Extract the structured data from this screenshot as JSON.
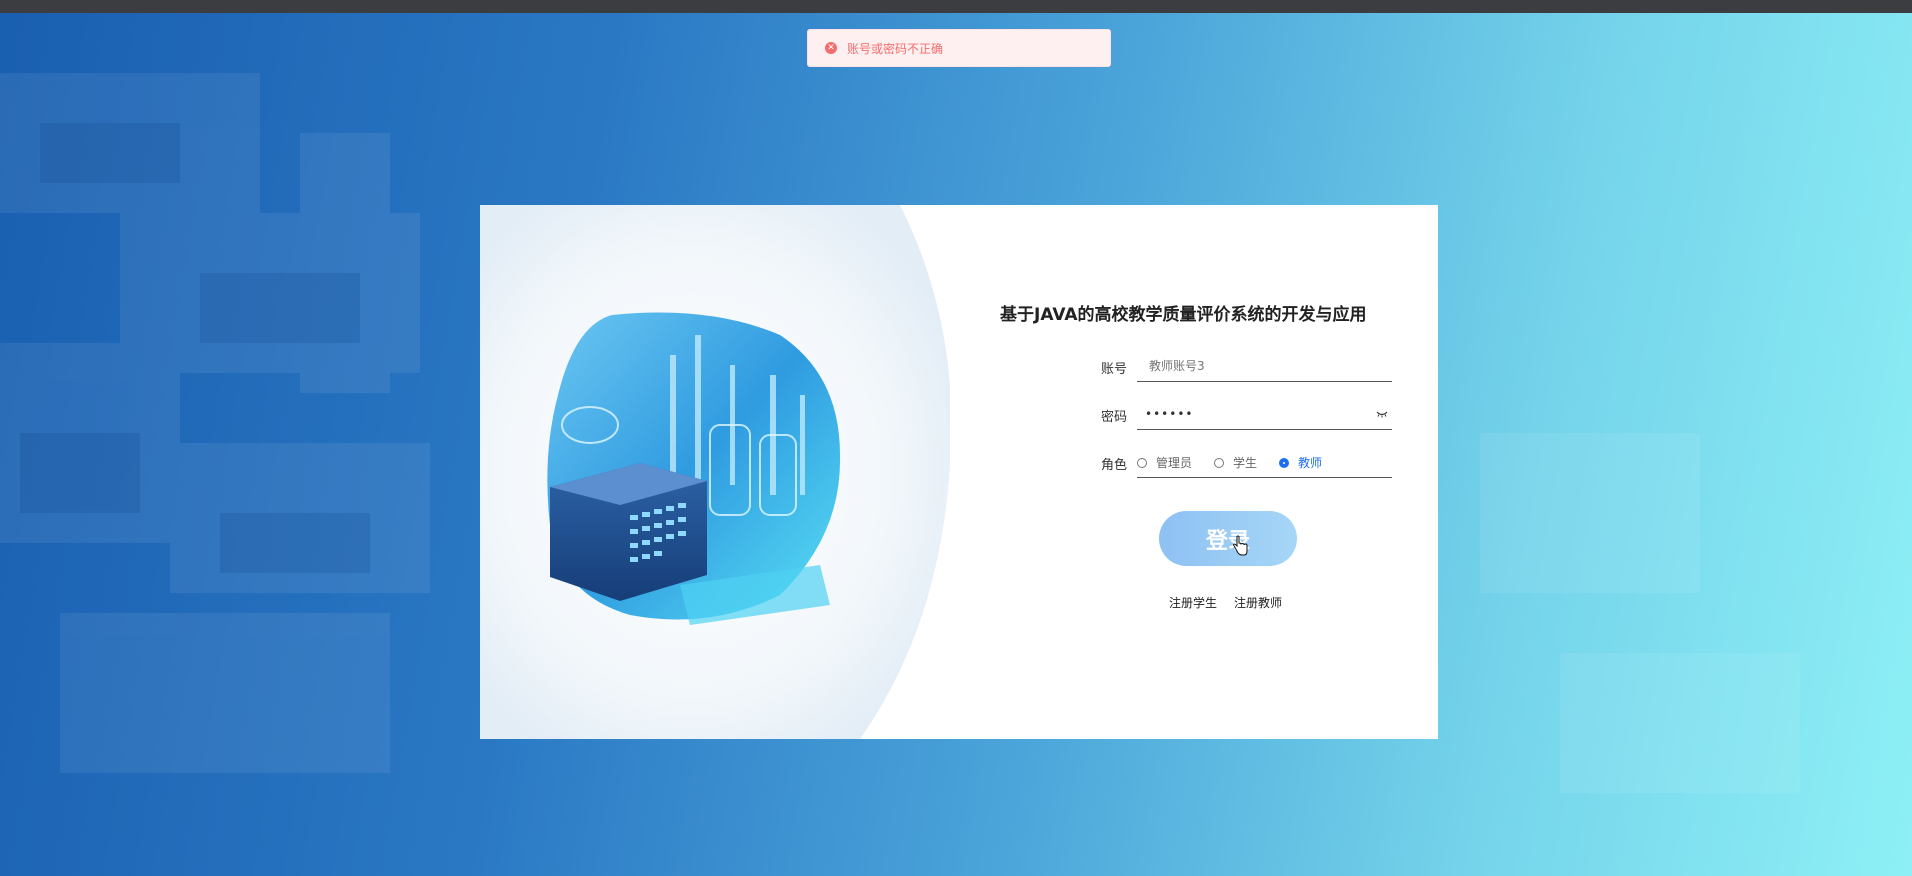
{
  "toast": {
    "icon": "error-circle-icon",
    "message": "账号或密码不正确"
  },
  "login": {
    "title": "基于JAVA的高校教学质量评价系统的开发与应用",
    "account_label": "账号",
    "account_placeholder": "教师账号3",
    "password_label": "密码",
    "password_value": "••••••",
    "role_label": "角色",
    "roles": [
      {
        "label": "管理员",
        "checked": false
      },
      {
        "label": "学生",
        "checked": false
      },
      {
        "label": "教师",
        "checked": true
      }
    ],
    "submit_label": "登录",
    "links": [
      "注册学生",
      "注册教师"
    ]
  },
  "colors": {
    "accent": "#1e6ff0",
    "error": "#f56c6c",
    "button": "#8dc1f3"
  }
}
